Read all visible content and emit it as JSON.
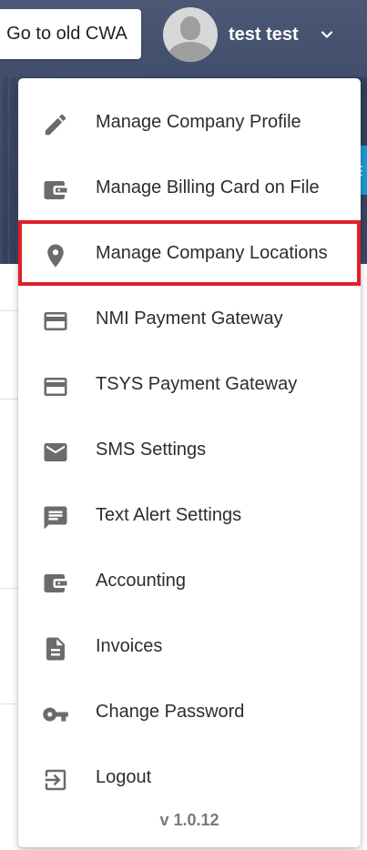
{
  "header": {
    "old_cwa_label": "Go to old CWA",
    "user_name": "test test",
    "icons": {
      "avatar": "avatar-icon",
      "chevron": "chevron-down-icon"
    }
  },
  "menu": {
    "items": [
      {
        "label": "Manage Company Profile",
        "icon": "pencil-icon"
      },
      {
        "label": "Manage Billing Card on File",
        "icon": "wallet-icon"
      },
      {
        "label": "Manage Company Locations",
        "icon": "location-pin-icon",
        "highlighted": true
      },
      {
        "label": "NMI Payment Gateway",
        "icon": "credit-card-icon"
      },
      {
        "label": "TSYS Payment Gateway",
        "icon": "credit-card-icon"
      },
      {
        "label": "SMS Settings",
        "icon": "envelope-icon"
      },
      {
        "label": "Text Alert Settings",
        "icon": "chat-bubble-icon"
      },
      {
        "label": "Accounting",
        "icon": "wallet-icon"
      },
      {
        "label": "Invoices",
        "icon": "document-icon"
      },
      {
        "label": "Change Password",
        "icon": "key-icon"
      },
      {
        "label": "Logout",
        "icon": "logout-icon"
      }
    ],
    "version": "v 1.0.12"
  },
  "colors": {
    "header_bg": "#3e4a66",
    "icon": "#6b6b6b",
    "highlight_border": "#e0202a",
    "accent_tab": "#1a9bd7"
  }
}
